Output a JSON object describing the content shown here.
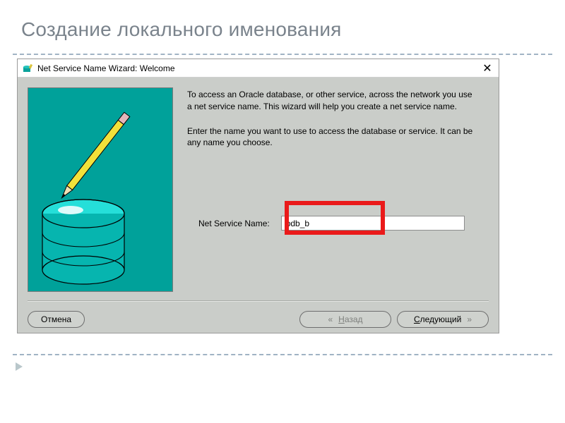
{
  "slide": {
    "heading": "Создание локального именования"
  },
  "wizard": {
    "title": "Net Service Name Wizard: Welcome",
    "close": "✕",
    "para1": "To access an Oracle database, or other service, across the network you use a net service name.  This wizard will help you create a net service name.",
    "para2": "Enter the name you want to use to access the database or service. It can be any name you choose.",
    "field_label": "Net Service Name:",
    "field_value": "pdb_b",
    "buttons": {
      "cancel": "Отмена",
      "back_letter": "Н",
      "back_rest": "азад",
      "next_letter": "С",
      "next_rest": "ледующий",
      "chev_left": "«",
      "chev_right": "»"
    }
  }
}
